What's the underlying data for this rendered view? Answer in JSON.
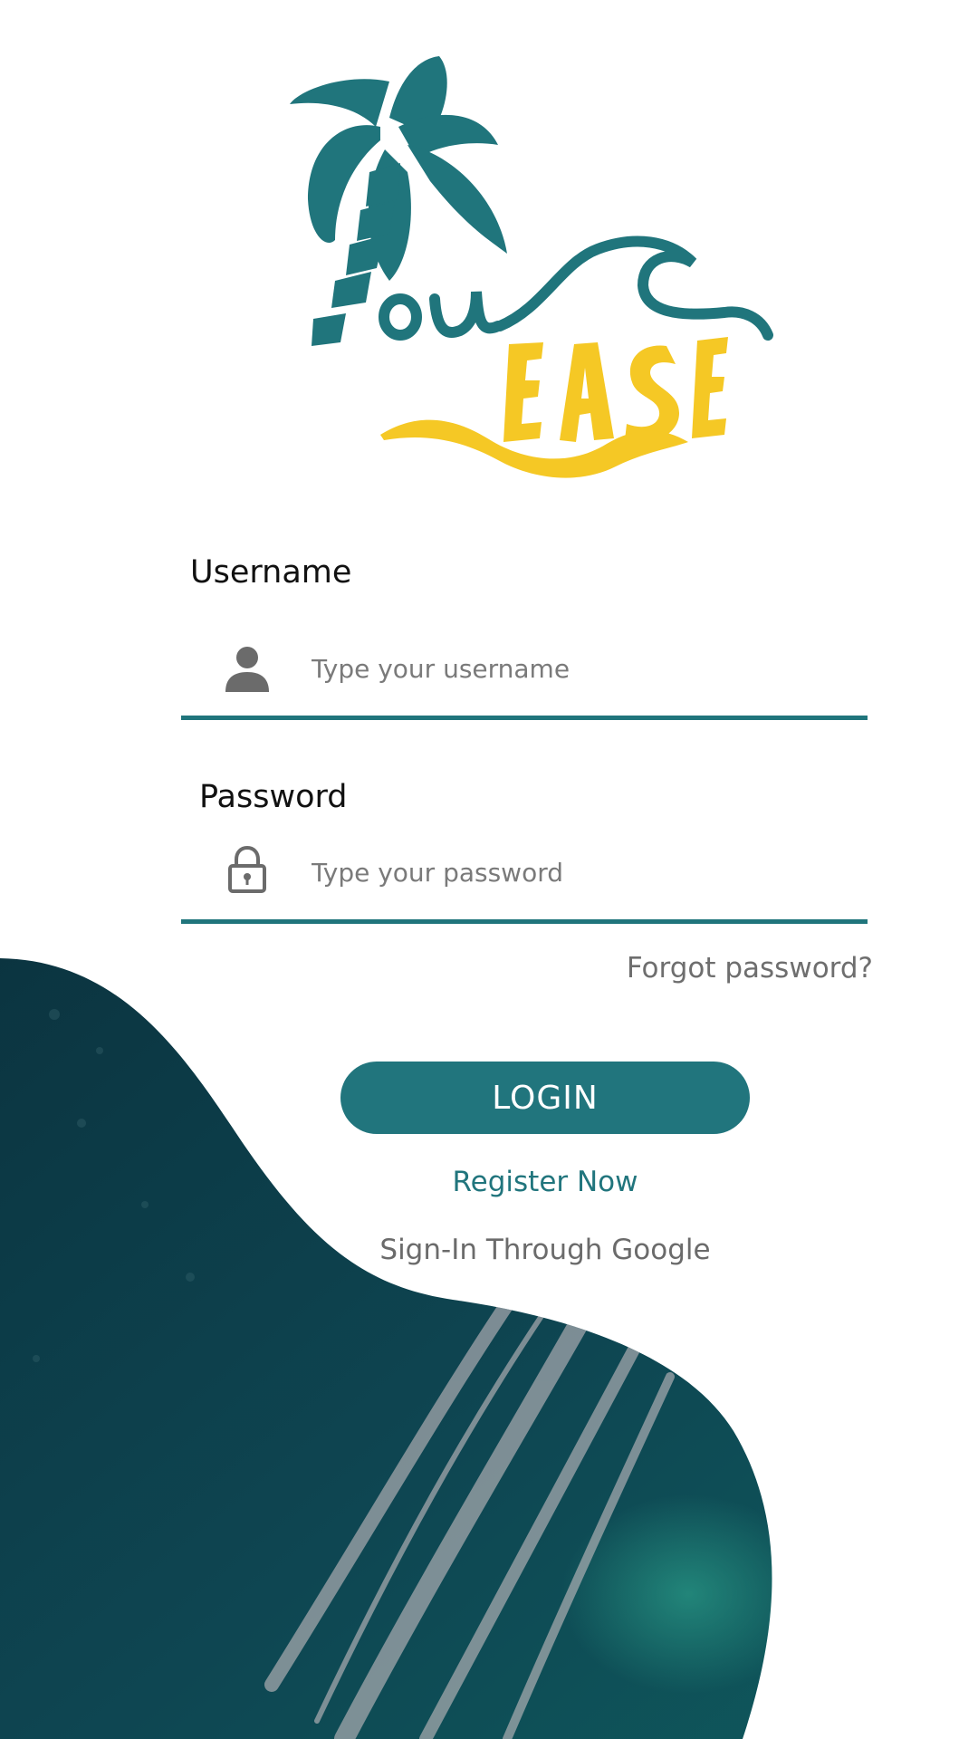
{
  "colors": {
    "primary": "#21757d",
    "accent_yellow": "#f5c825",
    "ocean_dark": "#0d3f4b"
  },
  "logo": {
    "icon": "palm-tree-logo",
    "alt": "Tour Ease"
  },
  "form": {
    "username": {
      "label": "Username",
      "placeholder": "Type your username",
      "value": "",
      "icon": "user-icon"
    },
    "password": {
      "label": "Password",
      "placeholder": "Type your password",
      "value": "",
      "icon": "lock-icon"
    },
    "forgot_label": "Forgot password?",
    "login_label": "LOGIN",
    "register_label": "Register Now",
    "google_label": "Sign-In Through Google"
  }
}
